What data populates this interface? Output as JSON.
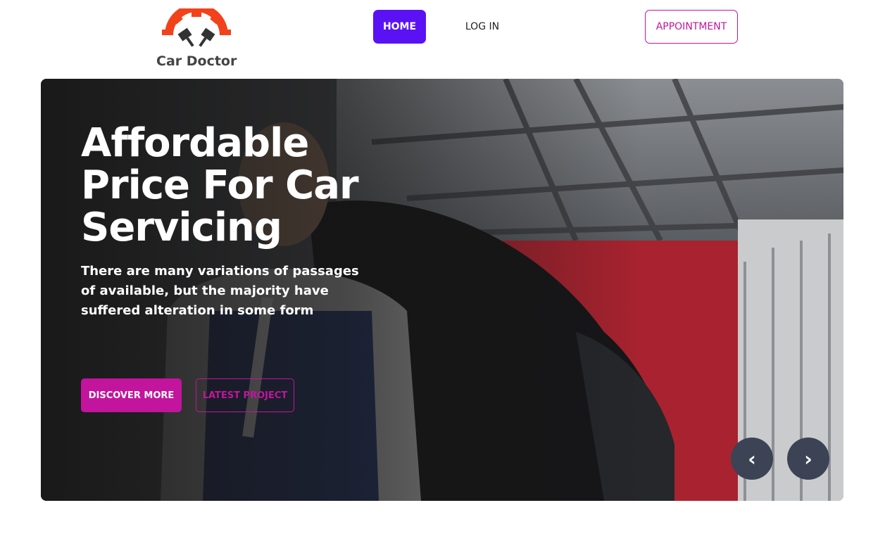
{
  "brand": {
    "name": "Car Doctor",
    "logo_icon": "gear-pistons-icon",
    "logo_color": "#f2421b"
  },
  "nav": {
    "home_label": "HOME",
    "login_label": "LOG IN",
    "appointment_label": "APPOINTMENT"
  },
  "hero": {
    "title": "Affordable Price For Car Servicing",
    "subtitle": "There are many variations of passages of available, but the majority have suffered alteration in some form",
    "discover_label": "DISCOVER MORE",
    "latest_label": "LATEST PROJECT",
    "prev_icon": "chevron-left-icon",
    "next_icon": "chevron-right-icon",
    "prev_glyph": "‹",
    "next_glyph": "›"
  },
  "colors": {
    "accent": "#c3149e",
    "primary": "#5a12f5",
    "arrow_bg": "#3b4354",
    "logo": "#f2421b"
  }
}
